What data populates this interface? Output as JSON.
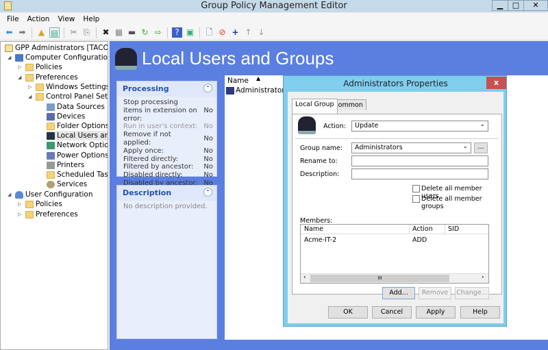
{
  "window": {
    "title": "Group Policy Management Editor",
    "minimize": "▁",
    "maximize": "□",
    "close": "✕"
  },
  "menu": [
    "File",
    "Action",
    "View",
    "Help"
  ],
  "tree": {
    "root": "GPP Administrators [TACO.ACM",
    "computer_config": "Computer Configuration",
    "policies": "Policies",
    "preferences": "Preferences",
    "windows_settings": "Windows Settings",
    "control_panel": "Control Panel Settings",
    "cp_items": [
      "Data Sources",
      "Devices",
      "Folder Options",
      "Local Users and Groups",
      "Network Options",
      "Power Options",
      "Printers",
      "Scheduled Tasks",
      "Services"
    ],
    "user_config": "User Configuration",
    "user_policies": "Policies",
    "user_preferences": "Preferences"
  },
  "main": {
    "title": "Local Users and Groups",
    "processing": {
      "title": "Processing",
      "rows": [
        {
          "label": "Stop processing items in extension on error:",
          "value": "No",
          "disabled": false
        },
        {
          "label": "Run in user's context:",
          "value": "No",
          "disabled": true
        },
        {
          "label": "Remove if not applied:",
          "value": "No",
          "disabled": false
        },
        {
          "label": "Apply once:",
          "value": "No",
          "disabled": false
        },
        {
          "label": "Filtered directly:",
          "value": "No",
          "disabled": false
        },
        {
          "label": "Filtered by ancestor:",
          "value": "No",
          "disabled": false
        },
        {
          "label": "Disabled directly:",
          "value": "No",
          "disabled": false
        },
        {
          "label": "Disabled by ancestor:",
          "value": "No",
          "disabled": false
        }
      ]
    },
    "description": {
      "title": "Description",
      "text": "No description provided."
    },
    "list": {
      "column": "Name",
      "items": [
        "Administrators"
      ]
    }
  },
  "dialog": {
    "title": "Administrators Properties",
    "close": "x",
    "tabs": [
      "Local Group",
      "Common"
    ],
    "action_label": "Action:",
    "action_value": "Update",
    "group_name_label": "Group name:",
    "group_name_value": "Administrators",
    "browse": "...",
    "rename_label": "Rename to:",
    "rename_value": "",
    "description_label": "Description:",
    "description_value": "",
    "delete_users": "Delete all member users",
    "delete_groups": "Delete all member groups",
    "members_label": "Members:",
    "members_columns": [
      "Name",
      "Action",
      "SID"
    ],
    "members": [
      {
        "name": "Acme-IT-2",
        "action": "ADD",
        "sid": ""
      }
    ],
    "scroll_grip": "III",
    "add": "Add...",
    "remove": "Remove",
    "change": "Change...",
    "ok": "OK",
    "cancel": "Cancel",
    "apply": "Apply",
    "help": "Help"
  }
}
